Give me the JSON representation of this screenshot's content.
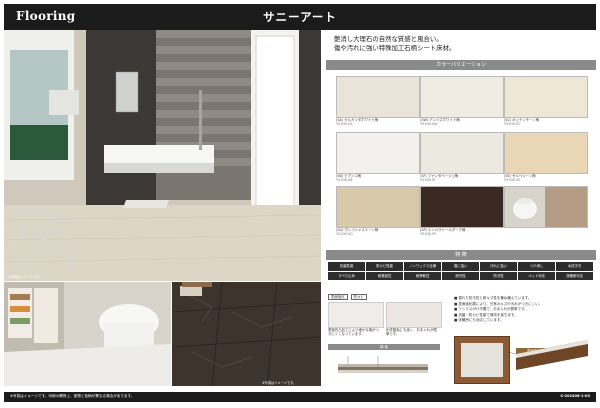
{
  "header": {
    "category": "Flooring",
    "product": "サニーアート"
  },
  "photos": {
    "main_caption": "※写真はイメージです。",
    "sub2_caption": "※写真はイメージです。"
  },
  "right": {
    "headline_1": "艶消し大理石の自然な質感と風合い。",
    "headline_2": "傷や汚れに強い特殊加工石柄シート床材。",
    "color_band": "カラーバリエーション",
    "swatches": [
      {
        "name": "(SA) カルカッタホワイト柄",
        "code": "YS106-SA",
        "color": "#e9e3d8"
      },
      {
        "name": "(SW) アンバスホワイト柄",
        "code": "YS106-SW",
        "color": "#f0ece4"
      },
      {
        "name": "(SC) ボッティチーノ柄",
        "code": "YS106-SC",
        "color": "#efe7d6"
      },
      {
        "name": "(SB) ビアンコ柄",
        "code": "YS106-SB",
        "color": "#f3f1ed"
      },
      {
        "name": "(SF) ファンタベージュ柄",
        "code": "YS106-SF",
        "color": "#ece9e1"
      },
      {
        "name": "(SE) セルベジーノ柄",
        "code": "YS106-SE",
        "color": "#e9d6b4"
      },
      {
        "name": "(SG) グレイシャストーン柄",
        "code": "YS106-SG",
        "color": "#d9c9ab"
      },
      {
        "name": "(SP) エンペラドールダーク柄",
        "code": "YS106-SP",
        "color": "#3a2a22"
      }
    ],
    "spec_band": "特 徴",
    "features": [
      "抗菌性能",
      "防カビ性能",
      "ノンワックス仕様",
      "傷に強い",
      "汚れに強い",
      "つや消し",
      "水拭き可",
      "すべり止め",
      "耐薬品性",
      "耐摩耗性",
      "耐光性",
      "防汚性",
      "ペット対応",
      "床暖房対応"
    ],
    "feature_labels_small": [
      "表面強化",
      "防カビ"
    ],
    "notes": [
      "表面凹凸加工により細かな傷がつきにくくなっています。",
      "化学薬品にも強く、お手入れが簡単です。"
    ],
    "bullets": [
      "■ 優れた防汚性と耐キズ性を兼ね備えています。",
      "■ 表面強化層により、日常のキズや汚れがつきにくい。",
      "■ ワックスがけ不要で、お手入れが簡単です。",
      "■ 抗菌・防カビ性能で清潔を保ちます。",
      "■ 床暖房にも対応しています。"
    ],
    "section_label": "構 造",
    "layer_label": "表面強化層"
  },
  "footer": {
    "note": "※写真はイメージです。印刷の関係上、実物と色柄が異なる場合があります。",
    "code": "S-202406-1-03"
  }
}
